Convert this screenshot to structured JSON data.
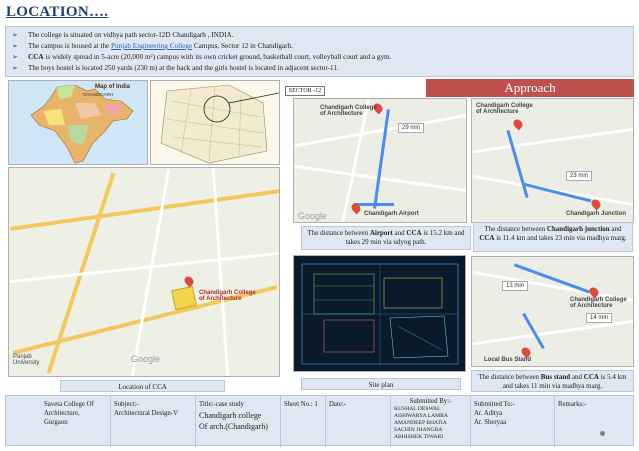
{
  "title": "LOCATION….",
  "bullets": [
    "The  college is situated on vidhya path  sector-12D Chandigarh , INDIA.",
    {
      "pre": "The campus is housed at the ",
      "link": "Punjab Engineering College",
      "post": " Campus, Sector 12 in Chandigarh."
    },
    {
      "bold": "CCA",
      "text": " is widely spread in 5-acre (20,000 m²) campus with its own cricket ground, basketball court, volleyball court and a gym."
    },
    " The boys hostel is located 250 yards (230 m) at the back and the girls hostel is located in adjacent sector-11."
  ],
  "bullet_marker": "➢",
  "maps": {
    "india_title": "Map of India",
    "india_label": "CHANDIGARH",
    "cca_label": "Chandigarh College of Architecture",
    "punjab_uni": "Panjab University",
    "google": "Google",
    "sector_label": "SECTOR -12",
    "approach": "Approach",
    "airport_cca_label": "Chandigarh College of Architecture",
    "airport_label": "Chandigarh Airport",
    "airport_time": "29 min",
    "junction_cca_label": "Chandigarh College of Architecture",
    "junction_label": "Chandigarh Junction",
    "junction_time": "23 min",
    "bus_cca_label": "Chandigarh College of Architecture",
    "bus_label": "Local Bus Stand",
    "bus_time_1": "13 min",
    "bus_time_2": "14 min"
  },
  "captions": {
    "location": "Location of CCA",
    "site_plan": "Site plan",
    "airport": {
      "pre": "The distance between ",
      "b1": "Airport",
      "mid": " and ",
      "b2": "CCA",
      "post": "  is 15.2 km and takes 29 min via  udyog path."
    },
    "junction": {
      "pre": "The distance between ",
      "b1": "Chandigarh junction",
      "mid": " and ",
      "b2": "CCA",
      "post": " is 11.4 km and takes 23 min via madhya marg."
    },
    "bus": {
      "pre": "The distance between ",
      "b1": "Bus stand",
      "mid": " and ",
      "b2": "CCA",
      "post": " is 5.4 km and takes 11 min via madhya marg."
    }
  },
  "footer": {
    "college": [
      "Saveta College Of",
      "Architecture,",
      "Gurgaon"
    ],
    "subject": [
      "Subject:-",
      "Architectural Design-V"
    ],
    "title_label": "Title:-case study",
    "title_value": [
      "Chandigarh college",
      "Of arch.(Chandigarh)"
    ],
    "sheet": "Sheet No.: 1",
    "date": "Date:-",
    "submitted_by_label": "Submitted By:-",
    "submitted_by": [
      "KUSHAL DESWAL",
      "AISHWARYA LAMBA",
      "AMANDEEP BHATIA",
      "SACHIN JHANGRA",
      "ABHISHEK TIWARI"
    ],
    "submitted_to_label": "Submitted To:-",
    "submitted_to": [
      "Ar. Aditya",
      "Ar. Sheryaa"
    ],
    "remarks": "Remarks:-"
  },
  "colors": {
    "title": "#1f3f73",
    "panel": "#dfe7f3",
    "approach": "#c0504d",
    "route": "#4a8cf0",
    "site_plan_bg": "#0b1a2a"
  }
}
